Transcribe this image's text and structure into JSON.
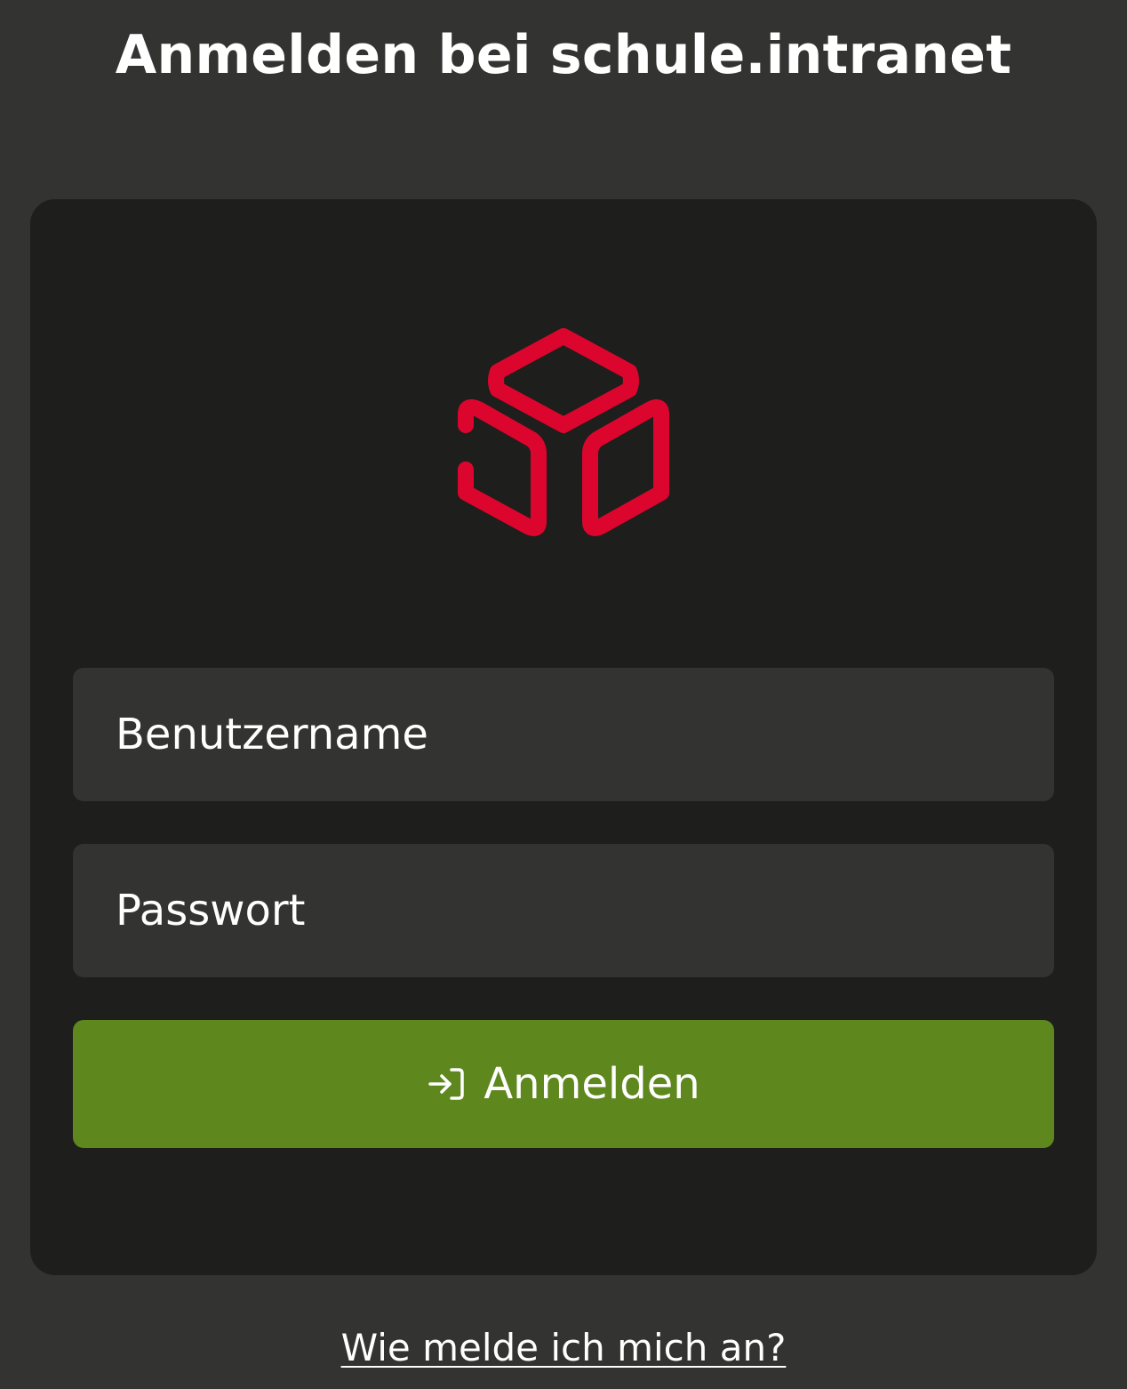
{
  "header": {
    "title": "Anmelden bei schule.intranet"
  },
  "logo": {
    "icon": "cube-logo-icon",
    "color": "#dc052d"
  },
  "form": {
    "username": {
      "placeholder": "Benutzername",
      "value": ""
    },
    "password": {
      "placeholder": "Passwort",
      "value": ""
    },
    "submit": {
      "label": "Anmelden",
      "icon": "login-arrow-icon",
      "color": "#5e871e"
    }
  },
  "help": {
    "link_text": "Wie melde ich mich an?"
  },
  "colors": {
    "page_background": "#333332",
    "card_background": "#1e1e1d",
    "input_background": "#333332",
    "text": "#ffffff"
  }
}
